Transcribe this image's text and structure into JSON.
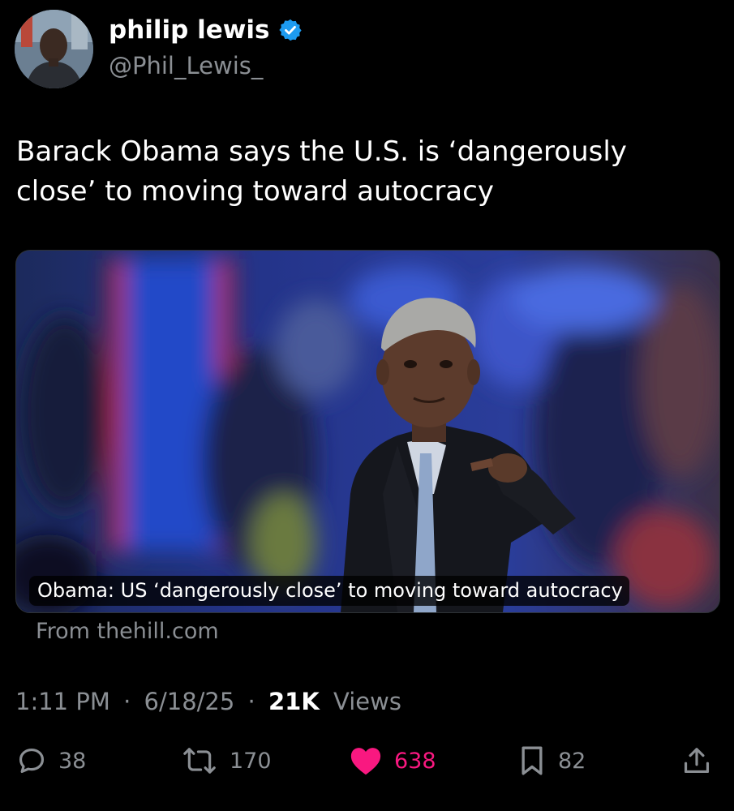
{
  "author": {
    "display_name": "philip lewis",
    "handle": "@Phil_Lewis_",
    "verified": true
  },
  "tweet": {
    "text": "Barack Obama says the U.S. is ‘dangerously close’ to moving toward autocracy"
  },
  "link_card": {
    "title": "Obama: US ‘dangerously close’ to moving toward autocracy",
    "source": "From thehill.com"
  },
  "meta": {
    "time": "1:11 PM",
    "date": "6/18/25",
    "views_count": "21K",
    "views_label": "Views",
    "separator": "·"
  },
  "actions": {
    "replies": "38",
    "reposts": "170",
    "likes": "638",
    "bookmarks": "82"
  },
  "colors": {
    "background": "#000000",
    "text_primary": "#ffffff",
    "text_secondary": "#8b8f94",
    "verified_badge": "#1d9bf0",
    "like_active": "#f91880"
  },
  "icons": {
    "verified": "verified-badge-icon",
    "reply": "speech-bubble-icon",
    "repost": "repost-arrows-icon",
    "like": "heart-icon",
    "bookmark": "bookmark-icon",
    "share": "share-upload-icon"
  }
}
